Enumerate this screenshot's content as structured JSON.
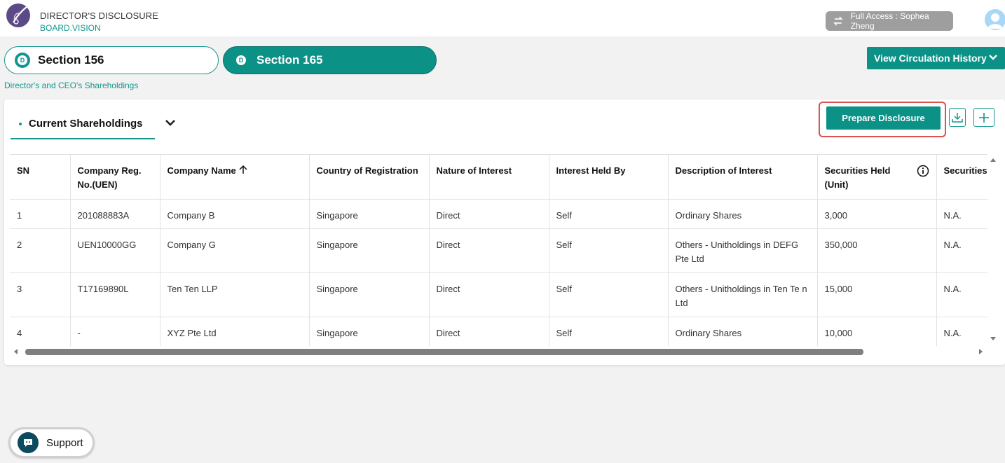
{
  "header": {
    "title": "DIRECTOR'S DISCLOSURE",
    "subtitle": "BOARD.VISION",
    "access": "Full Access : Sophea Zheng"
  },
  "sections": {
    "tab1": {
      "badge": "D",
      "label": "Section 156"
    },
    "tab2": {
      "badge": "D",
      "label": "Section 165"
    },
    "breadcrumb": "Director's and CEO's Shareholdings"
  },
  "circulation_button": "View Circulation History",
  "panel": {
    "tab_label": "Current Shareholdings",
    "prepare_button": "Prepare Disclosure"
  },
  "table": {
    "headers": [
      "SN",
      "Company Reg. No.(UEN)",
      "Company Name",
      "Country of Registration",
      "Nature of Interest",
      "Interest Held By",
      "Description of Interest",
      "Securities Held (Unit)",
      "Securities"
    ],
    "rows": [
      [
        "1",
        "201088883A",
        "Company B",
        "Singapore",
        "Direct",
        "Self",
        "Ordinary Shares",
        "3,000",
        "N.A."
      ],
      [
        "2",
        "UEN10000GG",
        "Company G",
        "Singapore",
        "Direct",
        "Self",
        "Others - Unitholdings in DEFG Pte Ltd",
        "350,000",
        "N.A."
      ],
      [
        "3",
        "T17169890L",
        "Ten Ten LLP",
        "Singapore",
        "Direct",
        "Self",
        "Others - Unitholdings in Ten Te n Ltd",
        "15,000",
        "N.A."
      ],
      [
        "4",
        "-",
        "XYZ Pte Ltd",
        "Singapore",
        "Direct",
        "Self",
        "Ordinary Shares",
        "10,000",
        "N.A."
      ]
    ]
  },
  "support": {
    "label": "Support"
  },
  "colors": {
    "accent": "#0c9187",
    "highlight": "#d9534f"
  },
  "icons": [
    "logo-icon",
    "swap-icon",
    "avatar-icon",
    "chevron-down-icon",
    "download-icon",
    "plus-icon",
    "sort-up-icon",
    "info-icon",
    "chat-icon"
  ]
}
